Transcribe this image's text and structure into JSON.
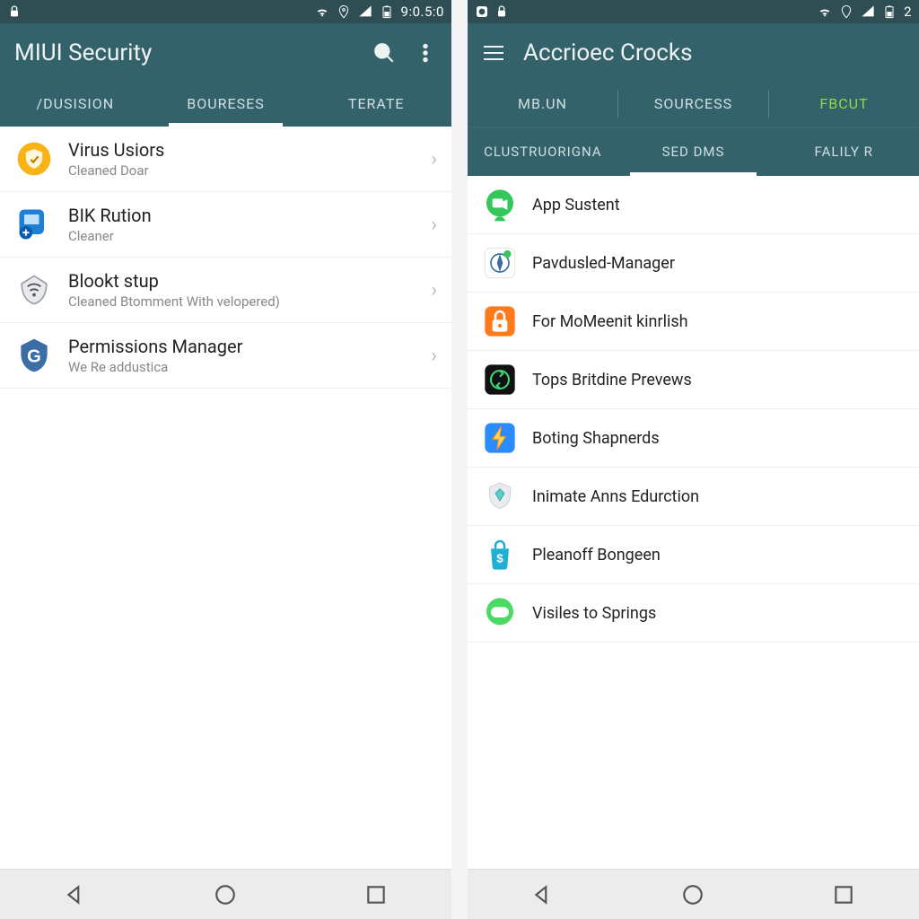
{
  "left": {
    "status": {
      "time": "9:0.5:0"
    },
    "title": "MIUI Security",
    "tabs": [
      {
        "label": "/DUSISION",
        "active": false
      },
      {
        "label": "BOURESES",
        "active": true
      },
      {
        "label": "TERATE",
        "active": false
      }
    ],
    "items": [
      {
        "title": "Virus Usiors",
        "subtitle": "Cleaned Doar"
      },
      {
        "title": "BIK Rution",
        "subtitle": "Cleaner"
      },
      {
        "title": "Blookt stup",
        "subtitle": "Cleaned Btomment With velopered)"
      },
      {
        "title": "Permissions Manager",
        "subtitle": "We Re addustica"
      }
    ]
  },
  "right": {
    "status": {
      "time": "2"
    },
    "title": "Accrioec Crocks",
    "tabs": [
      {
        "label": "MB.UN",
        "active": false
      },
      {
        "label": "SOURCESS",
        "active": false
      },
      {
        "label": "FBCUT",
        "active": false,
        "green": true
      }
    ],
    "subtabs": [
      {
        "label": "CLUSTRUORIGNA",
        "active": false
      },
      {
        "label": "SED DMS",
        "active": true
      },
      {
        "label": "FALILY R",
        "active": false
      }
    ],
    "apps": [
      {
        "title": "App Sustent"
      },
      {
        "title": "Pavdusled-Manager"
      },
      {
        "title": "For MoMeenit kinrlish"
      },
      {
        "title": "Tops Britdine Prevews"
      },
      {
        "title": "Boting Shapnerds"
      },
      {
        "title": "Inimate Anns Edurction"
      },
      {
        "title": "Pleanoff Bongeen"
      },
      {
        "title": "Visiles to Springs"
      }
    ]
  }
}
